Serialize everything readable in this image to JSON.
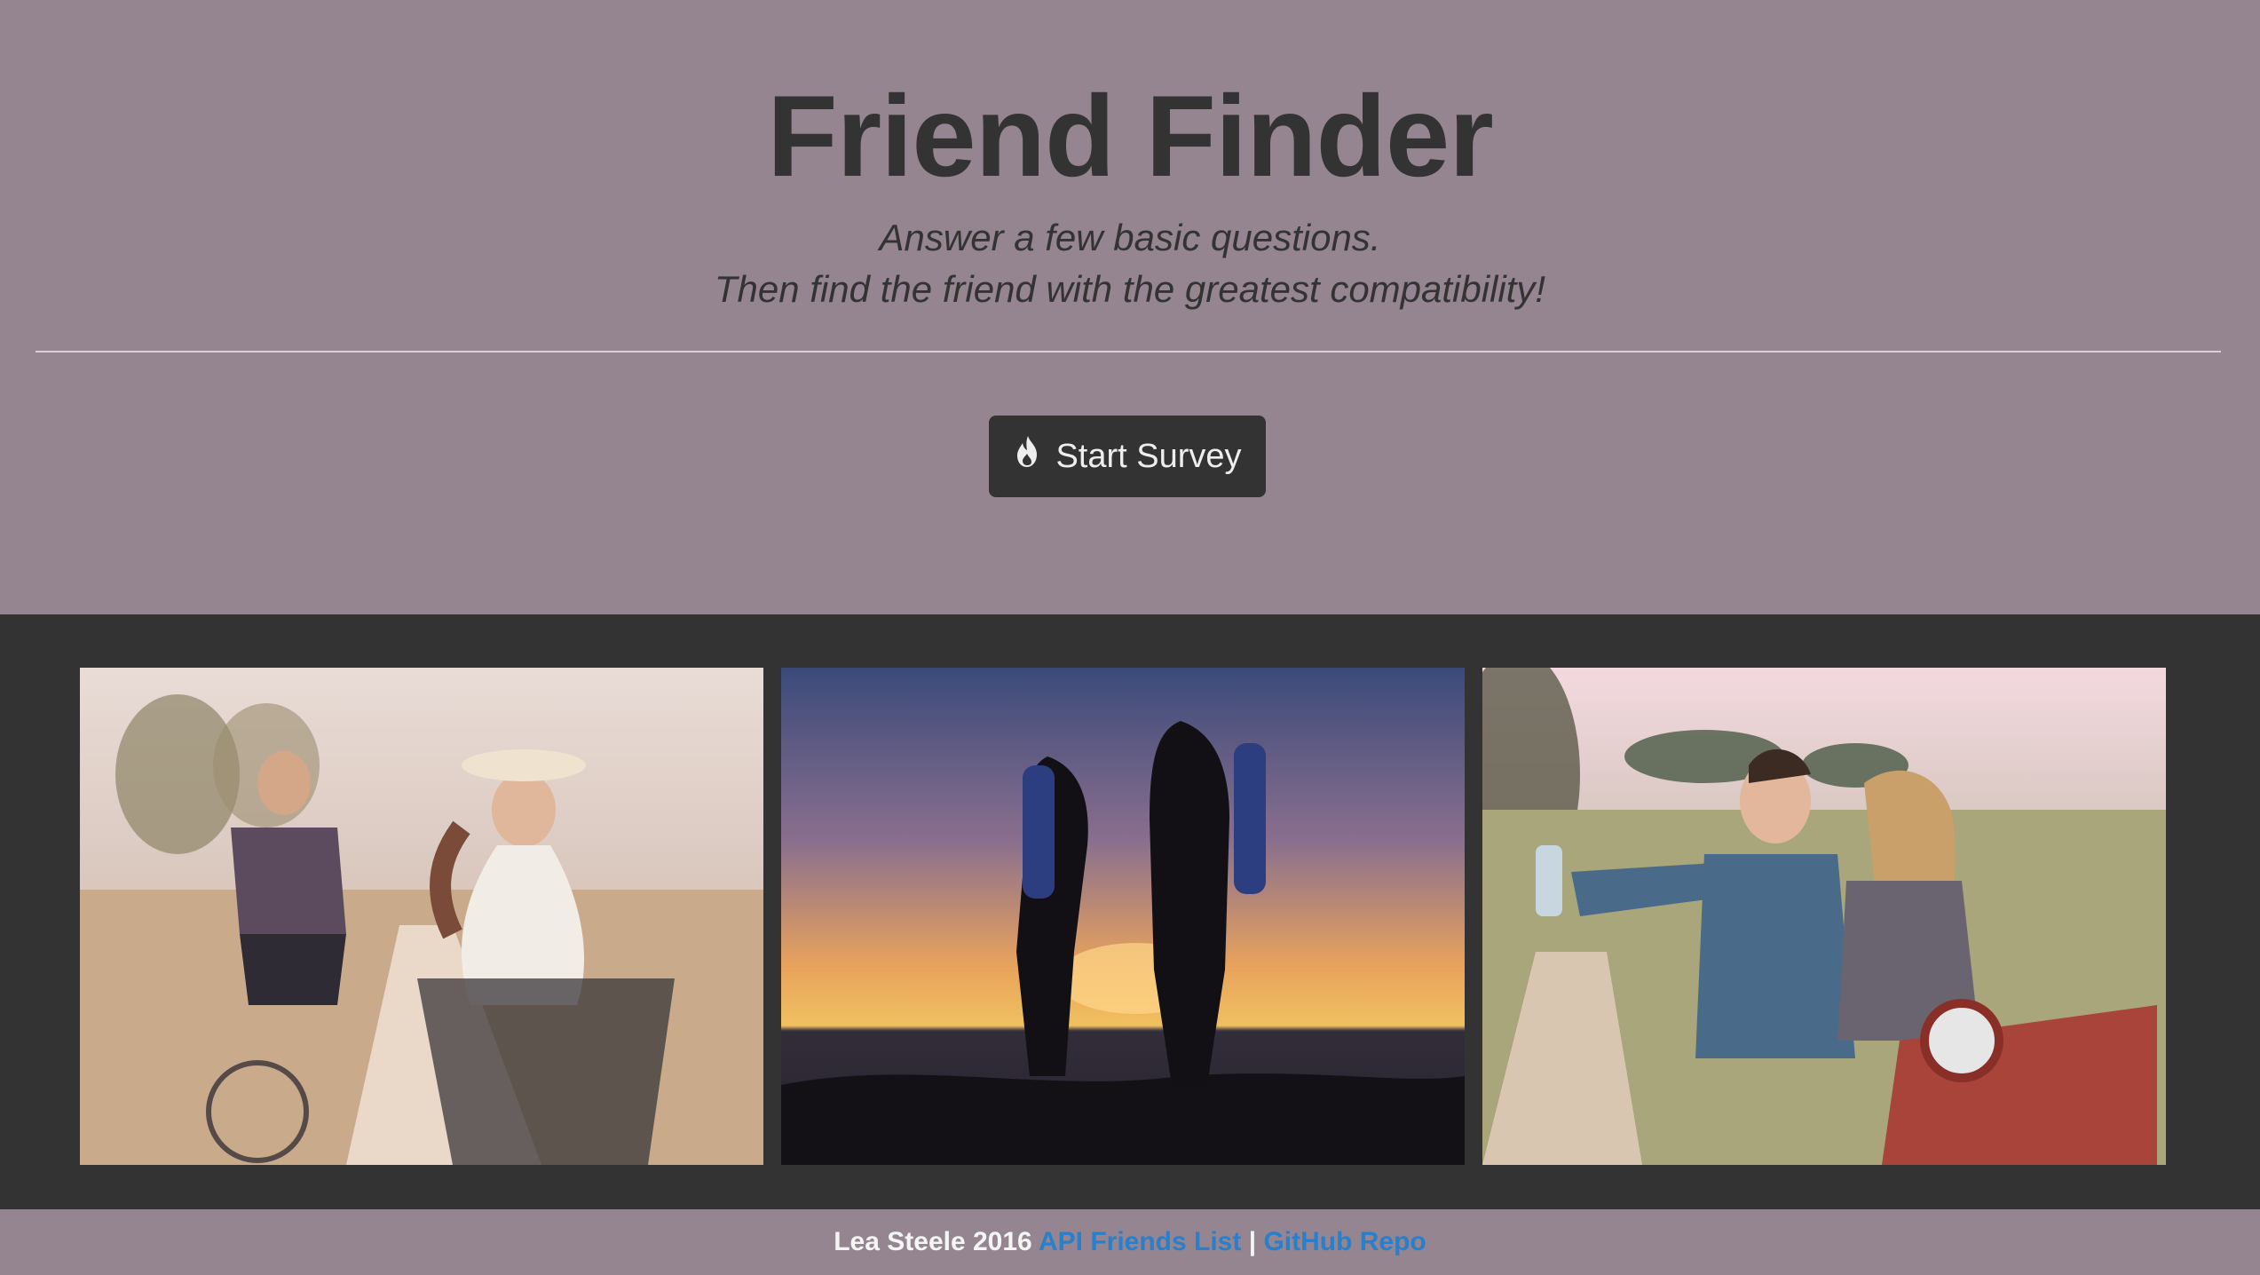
{
  "header": {
    "title": "Friend Finder",
    "subtitle_line1": "Answer a few basic questions.",
    "subtitle_line2": "Then find the friend with the greatest compatibility!",
    "start_button_label": "Start Survey",
    "start_button_icon": "fire-icon"
  },
  "gallery": {
    "photos": [
      {
        "name": "couple-biking-photo"
      },
      {
        "name": "hikers-sunset-photo"
      },
      {
        "name": "couple-scooter-photo"
      }
    ]
  },
  "footer": {
    "author": "Lea Steele 2016",
    "api_link": "API Friends List",
    "separator": "|",
    "github_link": "GitHub Repo"
  },
  "colors": {
    "background": "#948590",
    "dark": "#333333",
    "link": "#2a7fcb"
  }
}
